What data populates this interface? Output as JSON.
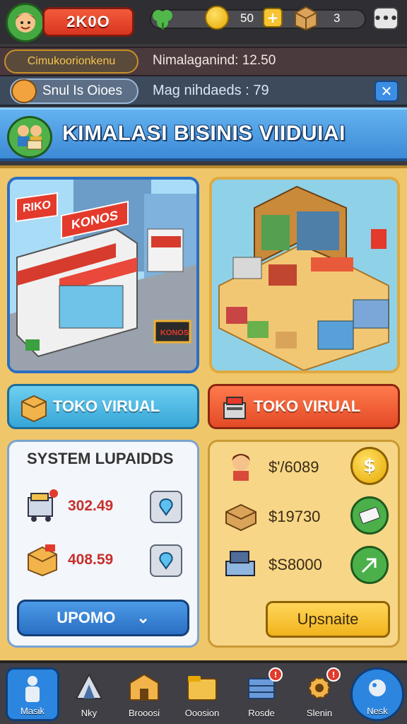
{
  "hud": {
    "player_name": "2K0O",
    "coins": "50",
    "boxes": "3",
    "plus_label": "+",
    "menu_label": "•••"
  },
  "info": {
    "pill_yellow": "Cimukoorionkenu",
    "row1_text": "Nimalaganind: 12.50",
    "pill_blue": "Snul Is Oioes",
    "row2_text": "Mag nihdaeds : 79",
    "close_label": "✕"
  },
  "title": "KIMALASI BISINIS VIIDUIAI",
  "scenes": {
    "left_sign_1": "RIKO",
    "left_sign_2": "KONOS",
    "left_sign_3": "KONOS"
  },
  "buttons": {
    "toko_left": "TOKO VIRUAL",
    "toko_right": "TOKO VIRUAL"
  },
  "system": {
    "title": "SYSTEM LUPAIDDS",
    "rows": [
      {
        "value": "302.49"
      },
      {
        "value": "408.59"
      }
    ],
    "upomo_label": "UPOMO",
    "chevron": "⌄"
  },
  "finance": {
    "rows": [
      {
        "value": "$'/6089"
      },
      {
        "value": "$19730"
      },
      {
        "value": "$S8000"
      }
    ],
    "upsnaite_label": "Upsnaite",
    "dollar_glyph": "$"
  },
  "nav": {
    "items": [
      {
        "label": "Masik"
      },
      {
        "label": "Nky"
      },
      {
        "label": "Brooosi"
      },
      {
        "label": "Ooosion"
      },
      {
        "label": "Rosde"
      },
      {
        "label": "Slenin"
      },
      {
        "label": "Nesk"
      }
    ],
    "badges": [
      "!",
      "!"
    ]
  },
  "colors": {
    "accent_blue": "#3d8ad6",
    "accent_red": "#e34a26",
    "accent_gold": "#f0c66a",
    "value_red": "#c7302b"
  }
}
